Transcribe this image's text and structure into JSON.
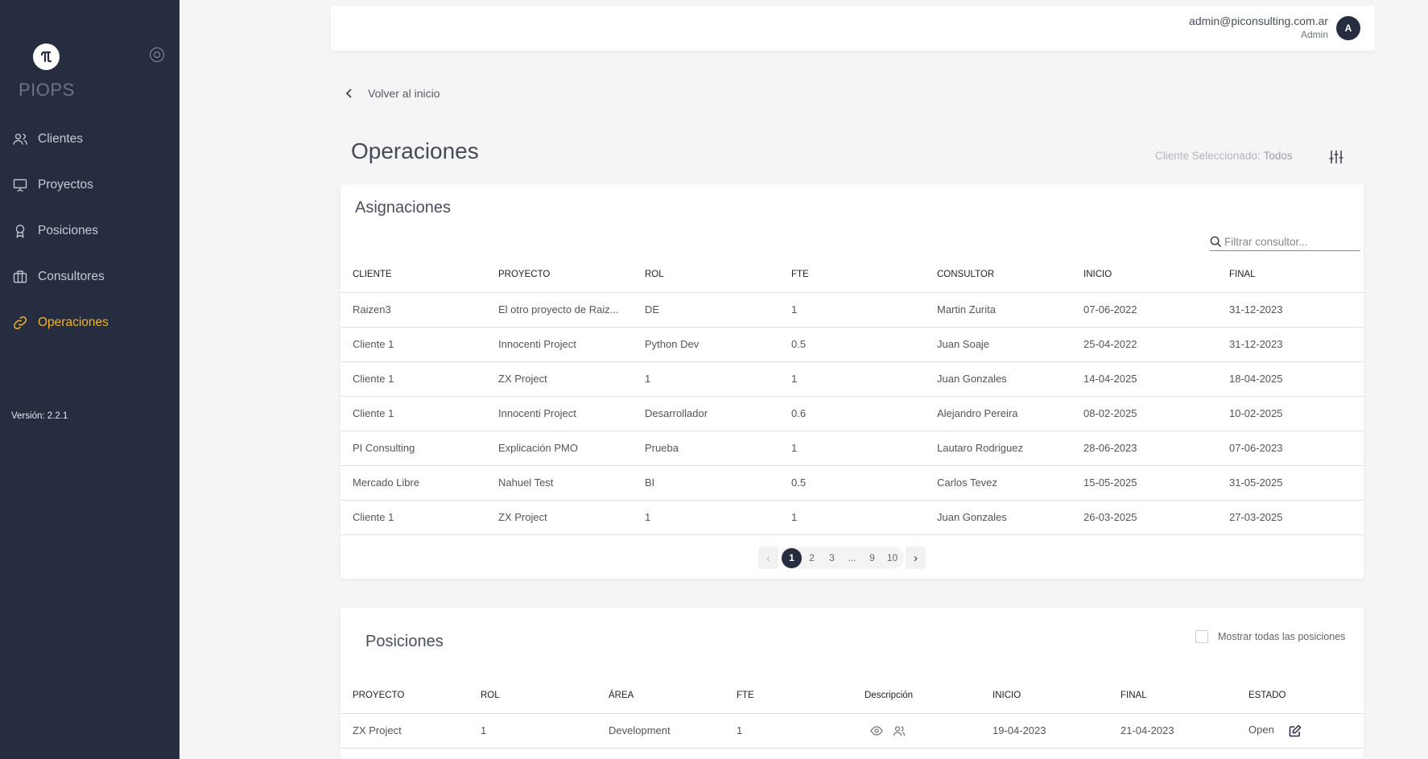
{
  "app": {
    "logo_text": "PIOPS",
    "version": "Versión: 2.2.1"
  },
  "sidebar": {
    "items": [
      {
        "label": "Clientes",
        "icon": "users-icon"
      },
      {
        "label": "Proyectos",
        "icon": "presentation-icon"
      },
      {
        "label": "Posiciones",
        "icon": "award-icon"
      },
      {
        "label": "Consultores",
        "icon": "briefcase-icon"
      },
      {
        "label": "Operaciones",
        "icon": "link-icon",
        "active": true
      }
    ],
    "active_color": "#f0b429"
  },
  "header": {
    "user_email": "admin@piconsulting.com.ar",
    "user_role": "Admin",
    "avatar_initial": "A"
  },
  "back_label": "Volver al inicio",
  "page": {
    "title": "Operaciones",
    "client_label": "Cliente Seleccionado:",
    "client_value": "Todos"
  },
  "asignaciones": {
    "title": "Asignaciones",
    "search_placeholder": "Filtrar consultor...",
    "columns": [
      "Cliente",
      "Proyecto",
      "Rol",
      "FTE",
      "Consultor",
      "Inicio",
      "Final"
    ],
    "rows": [
      [
        "Raizen3",
        "El otro proyecto de Raiz...",
        "DE",
        "1",
        "Martin Zurita",
        "07-06-2022",
        "31-12-2023"
      ],
      [
        "Cliente 1",
        "Innocenti Project",
        "Python Dev",
        "0.5",
        "Juan Soaje",
        "25-04-2022",
        "31-12-2023"
      ],
      [
        "Cliente 1",
        "ZX Project",
        "1",
        "1",
        "Juan Gonzales",
        "14-04-2025",
        "18-04-2025"
      ],
      [
        "Cliente 1",
        "Innocenti Project",
        "Desarrollador",
        "0.6",
        "Alejandro Pereira",
        "08-02-2025",
        "10-02-2025"
      ],
      [
        "PI Consulting",
        "Explicación PMO",
        "Prueba",
        "1",
        "Lautaro Rodriguez",
        "28-06-2023",
        "07-06-2023"
      ],
      [
        "Mercado Libre",
        "Nahuel Test",
        "BI",
        "0.5",
        "Carlos Tevez",
        "15-05-2025",
        "31-05-2025"
      ],
      [
        "Cliente 1",
        "ZX Project",
        "1",
        "1",
        "Juan Gonzales",
        "26-03-2025",
        "27-03-2025"
      ]
    ],
    "pagination": {
      "prev": "‹",
      "next": "›",
      "pages": [
        "1",
        "2",
        "3",
        "...",
        "9",
        "10"
      ],
      "current": "1"
    }
  },
  "posiciones": {
    "title": "Posiciones",
    "show_all_label": "Mostrar todas las posiciones",
    "columns": [
      "Proyecto",
      "Rol",
      "Área",
      "FTE",
      "Descripción",
      "Inicio",
      "Final",
      "Estado"
    ],
    "rows": [
      {
        "proyecto": "ZX Project",
        "rol": "1",
        "area": "Development",
        "fte": "1",
        "inicio": "19-04-2023",
        "final": "21-04-2023",
        "estado": "Open"
      }
    ]
  }
}
